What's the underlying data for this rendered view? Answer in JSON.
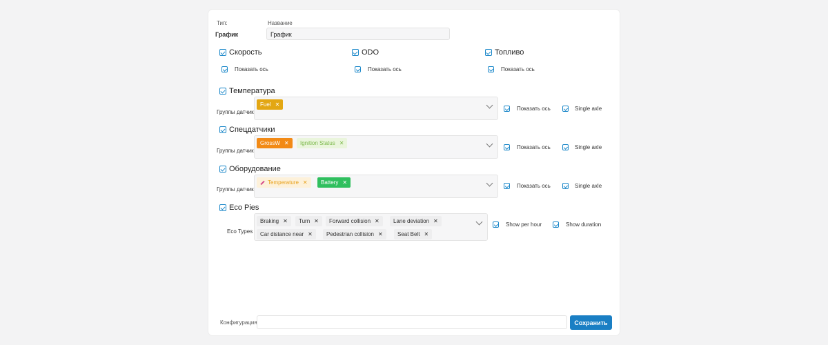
{
  "header": {
    "type_label": "Тип:",
    "type_value": "График",
    "name_label": "Название",
    "name_value": "График"
  },
  "metrics": [
    {
      "label": "Скорость",
      "show_axis": "Показать ось"
    },
    {
      "label": "ODO",
      "show_axis": "Показать ось"
    },
    {
      "label": "Топливо",
      "show_axis": "Показать ось"
    }
  ],
  "groups": [
    {
      "label": "Температура",
      "field_label": "Группы датчиков",
      "tags": [
        "Fuel"
      ],
      "show_axis": "Показать ось",
      "single_axle": "Single axle"
    },
    {
      "label": "Спецдатчики",
      "field_label": "Группы датчиков",
      "tags": [
        "GrossW",
        "Ignition Status"
      ],
      "show_axis": "Показать ось",
      "single_axle": "Single axle"
    },
    {
      "label": "Оборудование",
      "field_label": "Группы датчиков",
      "tags": [
        "Temperature",
        "Battery"
      ],
      "show_axis": "Показать ось",
      "single_axle": "Single axle"
    }
  ],
  "eco": {
    "label": "Eco Pies",
    "field_label": "Eco Types",
    "tags_row1": [
      "Braking",
      "Turn",
      "Forward collision",
      "Lane deviation"
    ],
    "tags_row2": [
      "Car distance near",
      "Pedestrian collision",
      "Seat Belt"
    ],
    "show_per_hour": "Show per hour",
    "show_duration": "Show duration"
  },
  "footer": {
    "config_label": "Конфигурация",
    "config_value": "",
    "save_label": "Сохранить"
  },
  "colors": {
    "accent": "#1a87c9",
    "save_button": "#1a7fc4",
    "tag_fuel": "#e3a713",
    "tag_grossw": "#f28a16",
    "tag_ignition": "#7bb84a",
    "tag_temperature": "#e8a21e",
    "tag_battery": "#2fbf5e"
  },
  "icons": {
    "checkbox": "checkbox-checked-icon",
    "dropdown": "chevron-down-icon",
    "remove": "close-icon",
    "tag_temperature": "pencil-icon"
  }
}
